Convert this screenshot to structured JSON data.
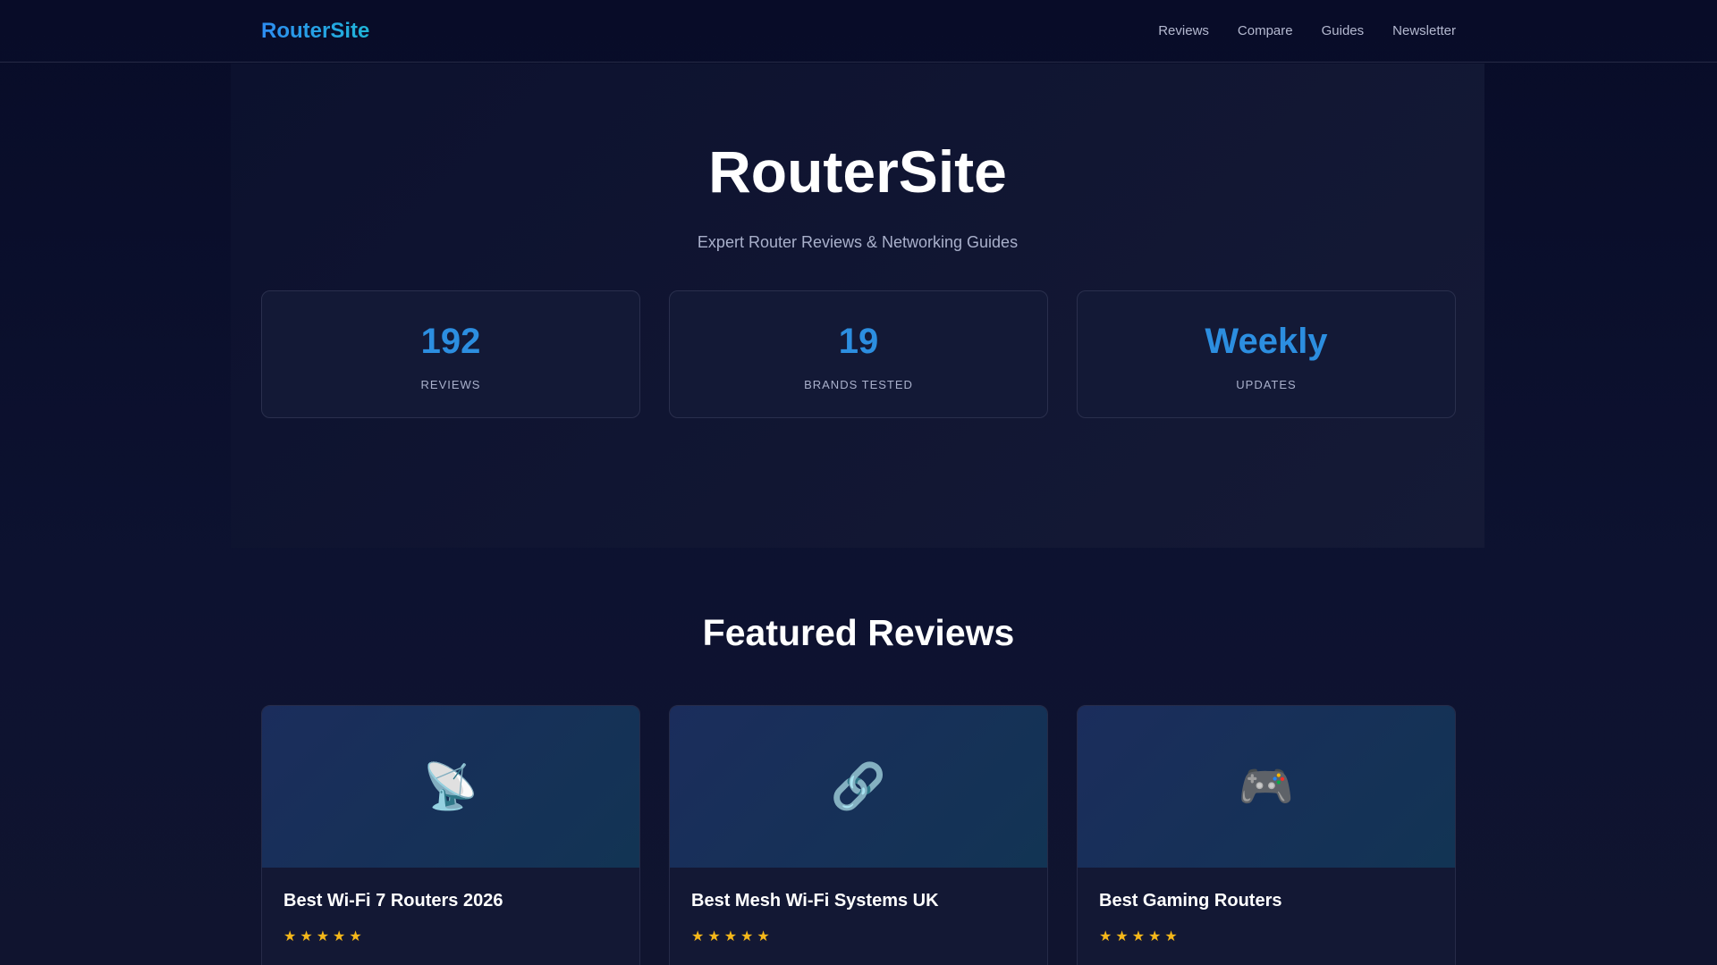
{
  "header": {
    "logo": "RouterSite",
    "nav": [
      "Reviews",
      "Compare",
      "Guides",
      "Newsletter"
    ]
  },
  "hero": {
    "title": "RouterSite",
    "subtitle": "Expert Router Reviews & Networking Guides",
    "stats": [
      {
        "value": "192",
        "label": "REVIEWS"
      },
      {
        "value": "19",
        "label": "BRANDS TESTED"
      },
      {
        "value": "Weekly",
        "label": "UPDATES"
      }
    ]
  },
  "featured": {
    "title": "Featured Reviews",
    "cards": [
      {
        "icon": "📡",
        "title": "Best Wi-Fi 7 Routers 2026",
        "stars": "★★★★★",
        "rating": 5
      },
      {
        "icon": "🔗",
        "title": "Best Mesh Wi-Fi Systems UK",
        "stars": "★★★★★",
        "rating": 5
      },
      {
        "icon": "🎮",
        "title": "Best Gaming Routers",
        "stars": "★★★★★",
        "rating": 5
      }
    ]
  }
}
